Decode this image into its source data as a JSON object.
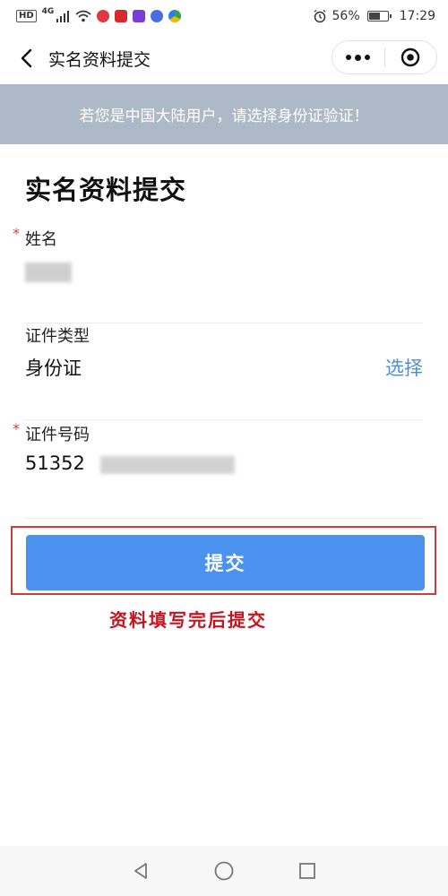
{
  "status_bar": {
    "hd": "HD",
    "network": "4G",
    "battery_percent": "56%",
    "battery_level": 0.56,
    "time": "17:29"
  },
  "nav": {
    "title": "实名资料提交",
    "back_icon": "chevron-left-icon",
    "more_icon": "more-dots-icon",
    "close_icon": "target-circle-icon"
  },
  "notice": {
    "text": "若您是中国大陆用户，请选择身份证验证！",
    "background": "#aeb9c7"
  },
  "form": {
    "title": "实名资料提交",
    "required_mark": "*",
    "name_label": "姓名",
    "id_type_label": "证件类型",
    "id_type_value": "身份证",
    "id_type_action": "选择",
    "id_number_label": "证件号码",
    "id_number_value": "51352"
  },
  "submit": {
    "label": "提交",
    "color": "#4a92ed"
  },
  "annotation": {
    "text": "资料填写完后提交",
    "color": "#c8141e"
  },
  "colors": {
    "link": "#4a90d9",
    "required": "#e23a3a"
  }
}
